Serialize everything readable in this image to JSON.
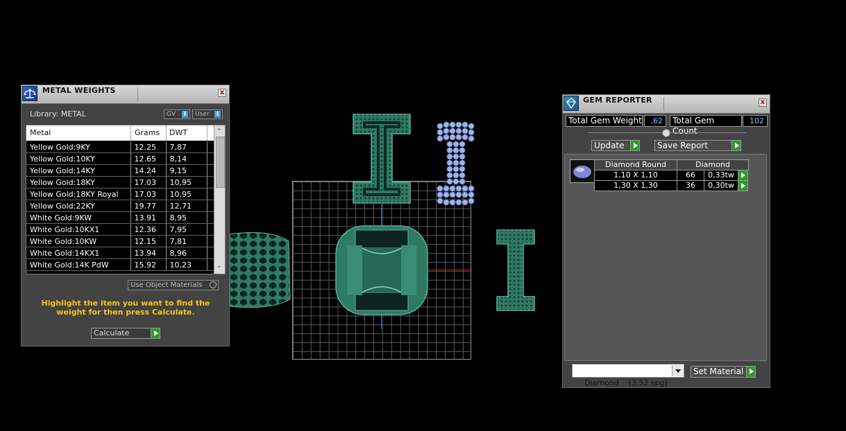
{
  "metal_weights": {
    "title": "METAL WEIGHTS",
    "library_label": "Library: METAL",
    "toggle_gv": "GV",
    "toggle_user": "User",
    "toggle_glyph": "I",
    "close_glyph": "x",
    "columns": [
      "Metal",
      "Grams",
      "DWT"
    ],
    "rows": [
      {
        "metal": "Yellow Gold:9KY",
        "grams": "12.25",
        "dwt": "7,87"
      },
      {
        "metal": "Yellow Gold:10KY",
        "grams": "12.65",
        "dwt": "8,14"
      },
      {
        "metal": "Yellow Gold:14KY",
        "grams": "14.24",
        "dwt": "9,15"
      },
      {
        "metal": "Yellow Gold:18KY",
        "grams": "17.03",
        "dwt": "10,95"
      },
      {
        "metal": "Yellow Gold:18KY Royal",
        "grams": "17.03",
        "dwt": "10,95"
      },
      {
        "metal": "Yellow Gold:22KY",
        "grams": "19.77",
        "dwt": "12,71"
      },
      {
        "metal": "White Gold:9KW",
        "grams": "13.91",
        "dwt": "8,95"
      },
      {
        "metal": "White Gold:10KX1",
        "grams": "12.36",
        "dwt": "7,95"
      },
      {
        "metal": "White Gold:10KW",
        "grams": "12.15",
        "dwt": "7,81"
      },
      {
        "metal": "White Gold:14KX1",
        "grams": "13.94",
        "dwt": "8,96"
      },
      {
        "metal": "White Gold:14K PdW",
        "grams": "15.92",
        "dwt": "10,23"
      }
    ],
    "use_object_materials_label": "Use Object Materials",
    "instruction": "Highlight the item you want to find the weight for then press Calculate.",
    "calculate_label": "Calculate"
  },
  "gem_reporter": {
    "title": "GEM REPORTER",
    "close_glyph": "x",
    "total_weight_label": "Total Gem Weight",
    "total_weight_value": ",62",
    "total_count_label": "Total Gem Count",
    "total_count_value": "102",
    "update_label": "Update",
    "save_report_label": "Save Report",
    "table_header": [
      "Diamond Round",
      "Diamond"
    ],
    "rows": [
      {
        "size": "1,10 X 1,10",
        "count": "66",
        "weight": "0,33tw"
      },
      {
        "size": "1,30 X 1,30",
        "count": "36",
        "weight": "0,30tw"
      }
    ],
    "material_select": "Diamond    (3,52 spg)",
    "set_material_label": "Set Material"
  },
  "viewport": {
    "accent_green": "#2e7a62",
    "gem_blue": "#9fb4e6"
  }
}
